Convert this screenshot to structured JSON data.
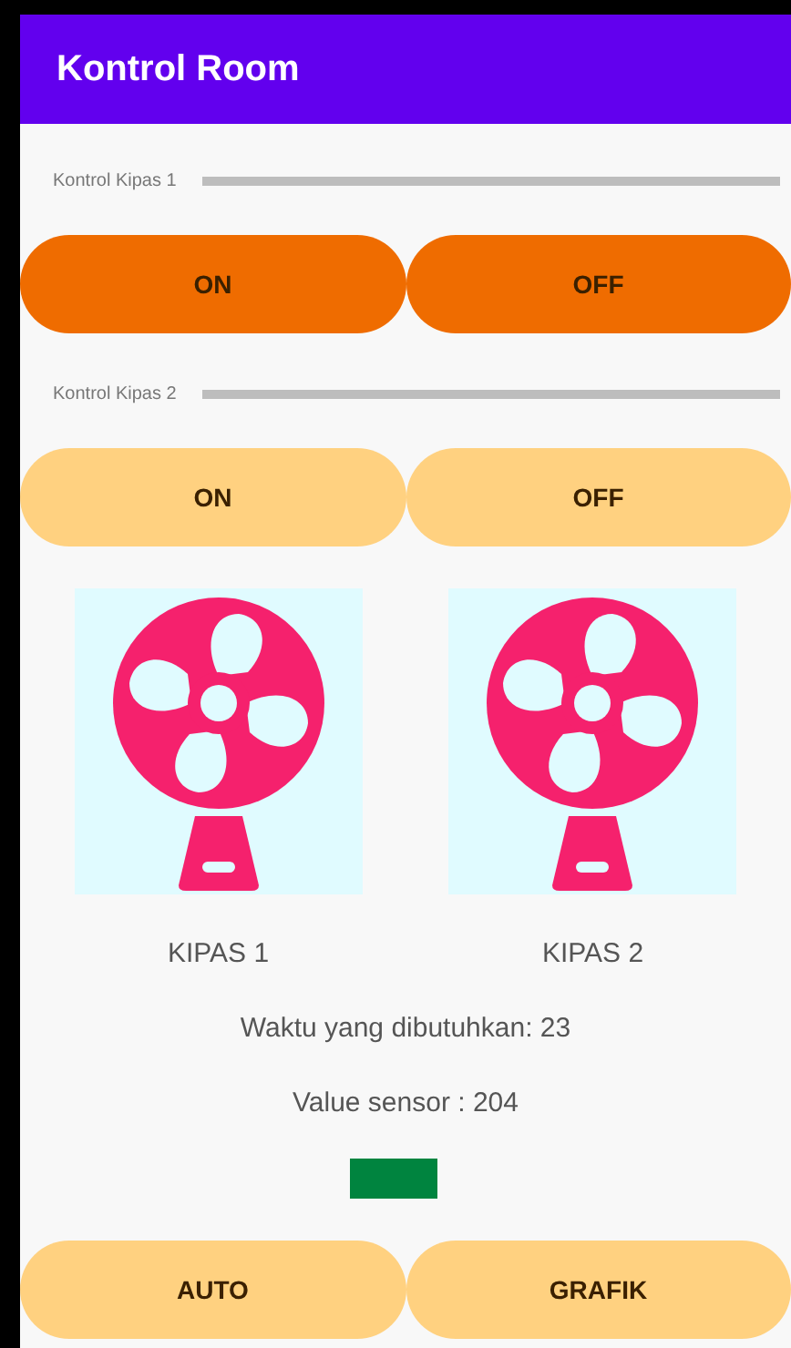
{
  "app_bar": {
    "title": "Kontrol Room"
  },
  "fan_controls": [
    {
      "label": "Kontrol Kipas 1",
      "level": 0,
      "active": true,
      "buttons": [
        "ON",
        "OFF"
      ]
    },
    {
      "label": "Kontrol Kipas 2",
      "level": 0,
      "active": false,
      "buttons": [
        "ON",
        "OFF"
      ]
    }
  ],
  "fans": [
    {
      "label": "KIPAS 1"
    },
    {
      "label": "KIPAS 2"
    }
  ],
  "time_text": "Waktu yang dibutuhkan: 23",
  "sensor_text": "Value sensor : 204",
  "indicator": {
    "color": "#00843f"
  },
  "bottom_buttons": [
    "AUTO",
    "GRAFIK"
  ]
}
